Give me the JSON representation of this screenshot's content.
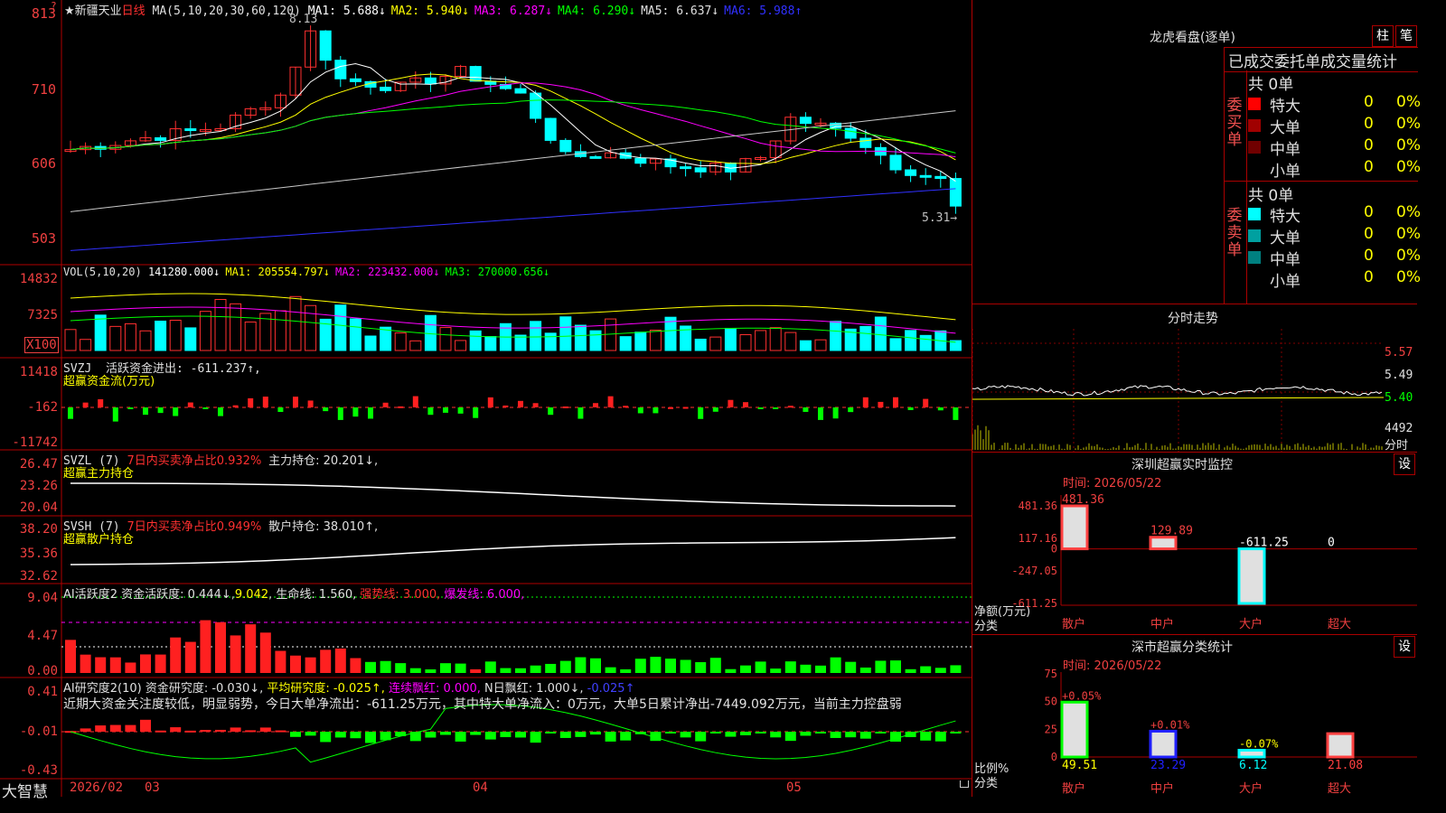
{
  "app": {
    "name": "大智慧"
  },
  "kline": {
    "stock": "★新疆天业",
    "period": "日线",
    "ma_title": "MA(5,10,20,30,60,120)",
    "ma_values": [
      {
        "label": "MA1: 5.688↓",
        "color": "#ffffff"
      },
      {
        "label": "MA2: 5.940↓",
        "color": "#ffff00"
      },
      {
        "label": "MA3: 6.287↓",
        "color": "#ff00ff"
      },
      {
        "label": "MA4: 6.290↓",
        "color": "#00ff00"
      },
      {
        "label": "MA5: 6.637↓",
        "color": "#e0e0e0"
      },
      {
        "label": "MA6: 5.988↑",
        "color": "#3030ff"
      }
    ],
    "yticks": [
      "813",
      "710",
      "606",
      "503"
    ],
    "high_label": "8.13",
    "low_label": "5.31→",
    "axis_range": [
      4.93,
      8.3
    ]
  },
  "volume": {
    "title": "VOL(5,10,20)",
    "values": [
      {
        "label": "141280.000↓",
        "color": "#ffffff"
      },
      {
        "label": "MA1: 205554.797↓",
        "color": "#ffff00"
      },
      {
        "label": "MA2: 223432.000↓",
        "color": "#ff00ff"
      },
      {
        "label": "MA3: 270000.656↓",
        "color": "#00ff00"
      }
    ],
    "yticks": [
      "14832",
      "7325"
    ],
    "unit": "X100"
  },
  "svzj": {
    "title": "SVZJ",
    "value_label": "活跃资金进出: -611.237↑,",
    "subtitle": "超赢资金流(万元)",
    "yticks": [
      "11418",
      "-162",
      "-11742"
    ]
  },
  "svzl": {
    "title": "SVZL (7)",
    "ratio_label": "7日内买卖净占比0.932%",
    "value_label": "主力持仓: 20.201↓,",
    "subtitle": "超赢主力持仓",
    "yticks": [
      "26.47",
      "23.26",
      "20.04"
    ]
  },
  "svsh": {
    "title": "SVSH (7)",
    "ratio_label": "7日内买卖净占比0.949%",
    "value_label": "散户持仓: 38.010↑,",
    "subtitle": "超赢散户持仓",
    "yticks": [
      "38.20",
      "35.36",
      "32.62"
    ]
  },
  "ai_active": {
    "title": "AI活跃度2",
    "fund_label": "资金活跃度: 0.444↓",
    "val2": "9.042",
    "life_label": "生命线: 1.560,",
    "strong_label": "强势线: 3.000,",
    "burst_label": "爆发线: 6.000,",
    "yticks": [
      "9.04",
      "4.47",
      "0.00"
    ]
  },
  "ai_research": {
    "title": "AI研究度2(10)",
    "fund_label": "资金研究度: -0.030↓,",
    "avg_label": "平均研究度: -0.025↑,",
    "red_label": "连续飘红: 0.000,",
    "n_red_label": "N日飘红: 1.000↓,",
    "last_label": "-0.025↑",
    "comment": "近期大资金关注度较低，明显弱势，今日大单净流出：-611.25万元，其中特大单净流入：0万元，大单5日累计净出-7449.092万元，当前主力控盘弱",
    "yticks": [
      "0.41",
      "-0.01",
      "-0.43"
    ]
  },
  "xaxis": {
    "labels": [
      "2026/02",
      "03",
      "04",
      "05"
    ]
  },
  "dragon": {
    "title": "龙虎看盘(逐单)",
    "btn_bar": "柱",
    "btn_pen": "笔",
    "header": "已成交委托单成交量统计",
    "buy_side": "委买单",
    "sell_side": "委卖单",
    "buy_total": "共 0单",
    "sell_total": "共 0单",
    "buy_rows": [
      {
        "name": "特大",
        "count": "0",
        "pct": "0%",
        "color": "#ff0000"
      },
      {
        "name": "大单",
        "count": "0",
        "pct": "0%",
        "color": "#a00000"
      },
      {
        "name": "中单",
        "count": "0",
        "pct": "0%",
        "color": "#700000"
      },
      {
        "name": "小单",
        "count": "0",
        "pct": "0%",
        "color": ""
      }
    ],
    "sell_rows": [
      {
        "name": "特大",
        "count": "0",
        "pct": "0%",
        "color": "#00ffff"
      },
      {
        "name": "大单",
        "count": "0",
        "pct": "0%",
        "color": "#00a0a0"
      },
      {
        "name": "中单",
        "count": "0",
        "pct": "0%",
        "color": "#008080"
      },
      {
        "name": "小单",
        "count": "0",
        "pct": "0%",
        "color": ""
      }
    ]
  },
  "intraday": {
    "title": "分时走势",
    "yticks": [
      "5.57",
      "5.49",
      "5.40"
    ],
    "vol_label": "4492",
    "unit": "分时"
  },
  "monitor": {
    "title": "深圳超赢实时监控",
    "btn": "设",
    "time_label": "时间: 2026/05/22",
    "yticks": [
      "481.36",
      "117.16",
      "0",
      "-247.05",
      "-611.25"
    ],
    "ylabel": "净额(万元)",
    "xlabel": "分类",
    "categories": [
      "散户",
      "中户",
      "大户",
      "超大"
    ],
    "values": [
      481.36,
      129.89,
      -611.25,
      0
    ],
    "value_labels": [
      "481.36",
      "129.89",
      "-611.25",
      "0"
    ]
  },
  "classify": {
    "title": "深市超赢分类统计",
    "btn": "设",
    "time_label": "时间: 2026/05/22",
    "yticks": [
      "75",
      "50",
      "25",
      "0"
    ],
    "ylabel": "比例%",
    "xlabel": "分类",
    "categories": [
      "散户",
      "中户",
      "大户",
      "超大"
    ],
    "values": [
      49.51,
      23.29,
      6.12,
      21.08
    ],
    "value_labels": [
      "49.51",
      "23.29",
      "6.12",
      "21.08"
    ],
    "change_labels": [
      "+0.05%",
      "+0.01%",
      "-0.07%",
      ""
    ]
  },
  "chart_data": [
    {
      "type": "bar",
      "title": "深圳超赢实时监控",
      "xlabel": "分类",
      "ylabel": "净额(万元)",
      "categories": [
        "散户",
        "中户",
        "大户",
        "超大"
      ],
      "values": [
        481.36,
        129.89,
        -611.25,
        0
      ]
    },
    {
      "type": "bar",
      "title": "深市超赢分类统计",
      "xlabel": "分类",
      "ylabel": "比例%",
      "categories": [
        "散户",
        "中户",
        "大户",
        "超大"
      ],
      "values": [
        49.51,
        23.29,
        6.12,
        21.08
      ],
      "ylim": [
        0,
        75
      ]
    }
  ]
}
